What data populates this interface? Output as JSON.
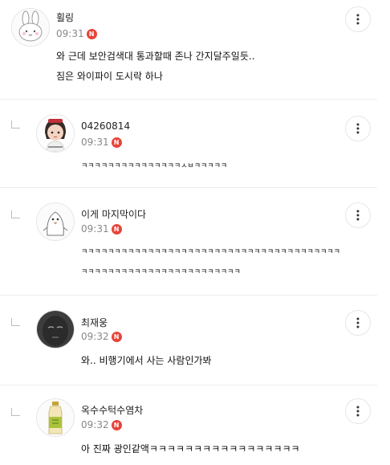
{
  "comments": [
    {
      "author": "휠링",
      "time": "09:31",
      "badge": "N",
      "lines": [
        "와 근데  보안검색대 통과할때 존나 간지달주일듯..",
        "짐은 와이파이 도시락 하나"
      ],
      "avatar_icon": "rabbit-icon",
      "is_reply": false
    },
    {
      "author": "04260814",
      "time": "09:31",
      "badge": "N",
      "lines": [
        "ㅋㅋㅋㅋㅋㅋㅋㅋㅋㅋㅋㅋㅋㅋㅋㅅㅂㅋㅋㅋㅋㅋ"
      ],
      "avatar_icon": "doll-icon",
      "is_reply": true
    },
    {
      "author": "이게 마지막이다",
      "time": "09:31",
      "badge": "N",
      "lines": [
        "ㅋㅋㅋㅋㅋㅋㅋㅋㅋㅋㅋㅋㅋㅋㅋㅋㅋㅋㅋㅋㅋㅋㅋㅋㅋㅋㅋㅋㅋㅋㅋㅋㅋㅋㅋㅋㅋㅋㅋ",
        "ㅋㅋㅋㅋㅋㅋㅋㅋㅋㅋㅋㅋㅋㅋㅋㅋㅋㅋㅋㅋㅋㅋㅋㅋ"
      ],
      "avatar_icon": "penguin-icon",
      "is_reply": true
    },
    {
      "author": "최재웅",
      "time": "09:32",
      "badge": "N",
      "lines": [
        "와.. 비행기에서 사는 사람인가봐"
      ],
      "avatar_icon": "dark-face-icon",
      "is_reply": true
    },
    {
      "author": "옥수수턱수염차",
      "time": "09:32",
      "badge": "N",
      "lines": [
        "아 진짜 광인같액ㅋㅋㅋㅋㅋㅋㅋㅋㅋㅋㅋㅋㅋㅋㅋㅋㅋ"
      ],
      "avatar_icon": "tea-bottle-icon",
      "is_reply": true
    }
  ],
  "colors": {
    "badge": "#e8443a",
    "divider": "#eeeeee",
    "meta": "#888888"
  }
}
